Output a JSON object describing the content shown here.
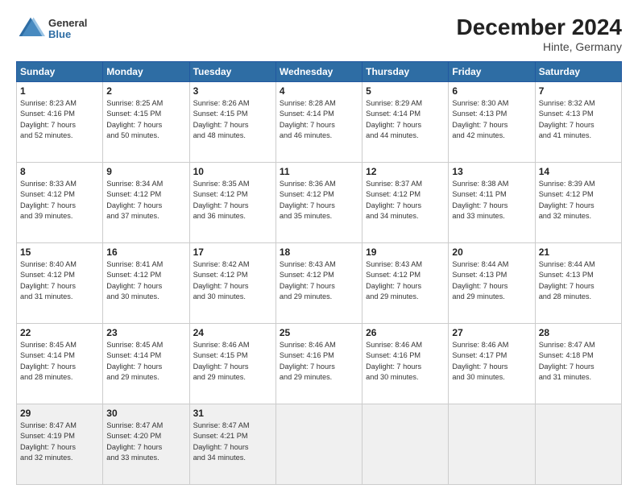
{
  "header": {
    "logo_general": "General",
    "logo_blue": "Blue",
    "month_year": "December 2024",
    "location": "Hinte, Germany"
  },
  "days_of_week": [
    "Sunday",
    "Monday",
    "Tuesday",
    "Wednesday",
    "Thursday",
    "Friday",
    "Saturday"
  ],
  "weeks": [
    [
      {
        "day": 1,
        "sunrise": "8:23 AM",
        "sunset": "4:16 PM",
        "daylight": "7 hours and 52 minutes."
      },
      {
        "day": 2,
        "sunrise": "8:25 AM",
        "sunset": "4:15 PM",
        "daylight": "7 hours and 50 minutes."
      },
      {
        "day": 3,
        "sunrise": "8:26 AM",
        "sunset": "4:15 PM",
        "daylight": "7 hours and 48 minutes."
      },
      {
        "day": 4,
        "sunrise": "8:28 AM",
        "sunset": "4:14 PM",
        "daylight": "7 hours and 46 minutes."
      },
      {
        "day": 5,
        "sunrise": "8:29 AM",
        "sunset": "4:14 PM",
        "daylight": "7 hours and 44 minutes."
      },
      {
        "day": 6,
        "sunrise": "8:30 AM",
        "sunset": "4:13 PM",
        "daylight": "7 hours and 42 minutes."
      },
      {
        "day": 7,
        "sunrise": "8:32 AM",
        "sunset": "4:13 PM",
        "daylight": "7 hours and 41 minutes."
      }
    ],
    [
      {
        "day": 8,
        "sunrise": "8:33 AM",
        "sunset": "4:12 PM",
        "daylight": "7 hours and 39 minutes."
      },
      {
        "day": 9,
        "sunrise": "8:34 AM",
        "sunset": "4:12 PM",
        "daylight": "7 hours and 37 minutes."
      },
      {
        "day": 10,
        "sunrise": "8:35 AM",
        "sunset": "4:12 PM",
        "daylight": "7 hours and 36 minutes."
      },
      {
        "day": 11,
        "sunrise": "8:36 AM",
        "sunset": "4:12 PM",
        "daylight": "7 hours and 35 minutes."
      },
      {
        "day": 12,
        "sunrise": "8:37 AM",
        "sunset": "4:12 PM",
        "daylight": "7 hours and 34 minutes."
      },
      {
        "day": 13,
        "sunrise": "8:38 AM",
        "sunset": "4:11 PM",
        "daylight": "7 hours and 33 minutes."
      },
      {
        "day": 14,
        "sunrise": "8:39 AM",
        "sunset": "4:12 PM",
        "daylight": "7 hours and 32 minutes."
      }
    ],
    [
      {
        "day": 15,
        "sunrise": "8:40 AM",
        "sunset": "4:12 PM",
        "daylight": "7 hours and 31 minutes."
      },
      {
        "day": 16,
        "sunrise": "8:41 AM",
        "sunset": "4:12 PM",
        "daylight": "7 hours and 30 minutes."
      },
      {
        "day": 17,
        "sunrise": "8:42 AM",
        "sunset": "4:12 PM",
        "daylight": "7 hours and 30 minutes."
      },
      {
        "day": 18,
        "sunrise": "8:43 AM",
        "sunset": "4:12 PM",
        "daylight": "7 hours and 29 minutes."
      },
      {
        "day": 19,
        "sunrise": "8:43 AM",
        "sunset": "4:12 PM",
        "daylight": "7 hours and 29 minutes."
      },
      {
        "day": 20,
        "sunrise": "8:44 AM",
        "sunset": "4:13 PM",
        "daylight": "7 hours and 29 minutes."
      },
      {
        "day": 21,
        "sunrise": "8:44 AM",
        "sunset": "4:13 PM",
        "daylight": "7 hours and 28 minutes."
      }
    ],
    [
      {
        "day": 22,
        "sunrise": "8:45 AM",
        "sunset": "4:14 PM",
        "daylight": "7 hours and 28 minutes."
      },
      {
        "day": 23,
        "sunrise": "8:45 AM",
        "sunset": "4:14 PM",
        "daylight": "7 hours and 29 minutes."
      },
      {
        "day": 24,
        "sunrise": "8:46 AM",
        "sunset": "4:15 PM",
        "daylight": "7 hours and 29 minutes."
      },
      {
        "day": 25,
        "sunrise": "8:46 AM",
        "sunset": "4:16 PM",
        "daylight": "7 hours and 29 minutes."
      },
      {
        "day": 26,
        "sunrise": "8:46 AM",
        "sunset": "4:16 PM",
        "daylight": "7 hours and 30 minutes."
      },
      {
        "day": 27,
        "sunrise": "8:46 AM",
        "sunset": "4:17 PM",
        "daylight": "7 hours and 30 minutes."
      },
      {
        "day": 28,
        "sunrise": "8:47 AM",
        "sunset": "4:18 PM",
        "daylight": "7 hours and 31 minutes."
      }
    ],
    [
      {
        "day": 29,
        "sunrise": "8:47 AM",
        "sunset": "4:19 PM",
        "daylight": "7 hours and 32 minutes."
      },
      {
        "day": 30,
        "sunrise": "8:47 AM",
        "sunset": "4:20 PM",
        "daylight": "7 hours and 33 minutes."
      },
      {
        "day": 31,
        "sunrise": "8:47 AM",
        "sunset": "4:21 PM",
        "daylight": "7 hours and 34 minutes."
      },
      null,
      null,
      null,
      null
    ]
  ]
}
